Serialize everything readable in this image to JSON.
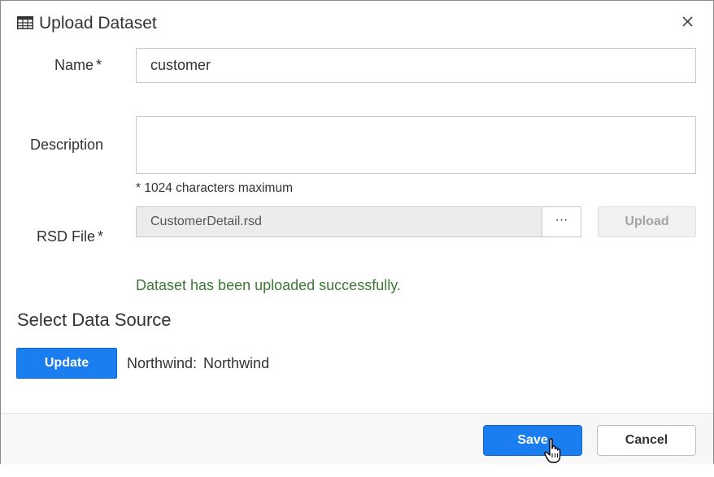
{
  "dialog": {
    "title": "Upload Dataset",
    "title_icon": "table-icon",
    "close_icon": "close-icon"
  },
  "form": {
    "name": {
      "label": "Name",
      "required_mark": "*",
      "value": "customer"
    },
    "description": {
      "label": "Description",
      "value": "",
      "hint_mark": "*",
      "hint": "1024 characters maximum"
    },
    "rsd_file": {
      "label": "RSD File",
      "required_mark": "*",
      "value": "CustomerDetail.rsd",
      "browse_label": "···",
      "upload_label": "Upload",
      "upload_enabled": false
    },
    "success_message": "Dataset has been uploaded successfully."
  },
  "data_source": {
    "heading": "Select Data Source",
    "update_label": "Update",
    "key": "Northwind:",
    "value": "Northwind"
  },
  "footer": {
    "save_label": "Save",
    "cancel_label": "Cancel"
  },
  "colors": {
    "primary": "#1a7ef0",
    "success": "#3c7a35",
    "disabled_text": "#a3a3a3"
  }
}
